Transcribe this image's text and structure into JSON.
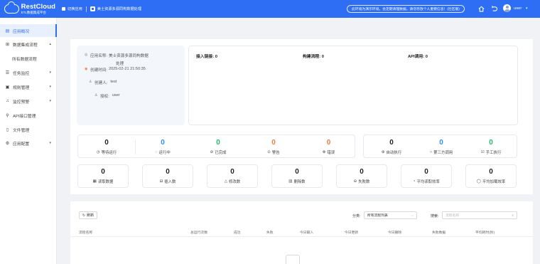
{
  "header": {
    "brand_title": "RestCloud",
    "brand_sub": "ETL数据集成平台",
    "nav_home": "切换应用",
    "app_name": "美士资源多源同构数据处理",
    "notice": "此环境为演示环境，会定期清理数据，请勿存放个人重要信息！(社区版)",
    "user": "user"
  },
  "sidebar": {
    "items": [
      {
        "label": "应用概况",
        "icon": "dashboard-icon",
        "active": true
      },
      {
        "label": "数据集成流程",
        "icon": "flow-icon",
        "caret": "▴"
      },
      {
        "label": "所有数据流程",
        "sub": true
      },
      {
        "label": "任务监控",
        "icon": "monitor-icon",
        "caret": "▾"
      },
      {
        "label": "规则管理",
        "icon": "rule-icon",
        "caret": "▾"
      },
      {
        "label": "监控预警",
        "icon": "bell-icon",
        "caret": "▾"
      },
      {
        "label": "API接口管理",
        "icon": "link-icon"
      },
      {
        "label": "文件管理",
        "icon": "file-icon"
      },
      {
        "label": "应用配置",
        "icon": "gear-icon",
        "caret": "▾"
      }
    ]
  },
  "app_info": {
    "name_label": "应用名称:",
    "name_value_1": "美士资源多源同构数据",
    "name_value_2": "处理",
    "created_label": "创建时间:",
    "created_value": "2025-02-21 21:50:35",
    "creator_label": "创建人:",
    "creator_value": "test",
    "auth_label": "授权:",
    "auth_value": "user"
  },
  "connections": {
    "access": "接入链接: 0",
    "build": "构建流程: 0",
    "api": "API调用: 0"
  },
  "status_stats": [
    {
      "value": "0",
      "label": "等待运行",
      "color": "#222222",
      "icon": "clock-icon"
    },
    {
      "value": "0",
      "label": "运行中",
      "color": "#2a8ff7",
      "icon": "spinner-icon"
    },
    {
      "value": "0",
      "label": "已完成",
      "color": "#19be6b",
      "icon": "check-circle-icon"
    },
    {
      "value": "0",
      "label": "警告",
      "color": "#f07b3f",
      "icon": "warning-icon"
    },
    {
      "value": "0",
      "label": "错误",
      "color": "#f07b3f",
      "icon": "error-icon"
    }
  ],
  "trigger_stats": [
    {
      "value": "0",
      "label": "自动执行",
      "color": "#222222",
      "icon": "auto-icon"
    },
    {
      "value": "0",
      "label": "第三方调用",
      "color": "#2a8ff7",
      "icon": "third-party-icon"
    },
    {
      "value": "0",
      "label": "手工执行",
      "color": "#19be6b",
      "icon": "manual-icon"
    }
  ],
  "data_stats": [
    {
      "value": "0",
      "label": "读取数据",
      "icon": "read-icon"
    },
    {
      "value": "0",
      "label": "插入数",
      "icon": "insert-icon"
    },
    {
      "value": "0",
      "label": "修改数",
      "icon": "edit-icon"
    },
    {
      "value": "0",
      "label": "删除数",
      "icon": "delete-icon"
    },
    {
      "value": "0",
      "label": "失败数",
      "icon": "fail-icon"
    },
    {
      "value": "0",
      "label": "平均读取效率",
      "icon": "read-rate-icon"
    },
    {
      "value": "0",
      "label": "平均加载效率",
      "icon": "load-rate-icon"
    }
  ],
  "list": {
    "refresh": "刷新",
    "category_label": "分类:",
    "category_value": "所有流程列表",
    "search_label": "搜索:",
    "search_placeholder": "流程名称",
    "columns": [
      "流程名称",
      "总运行次数",
      "成功",
      "失败",
      "今日输入",
      "今日更新",
      "今日删除",
      "失败数据",
      "平均耗时(秒)"
    ]
  }
}
